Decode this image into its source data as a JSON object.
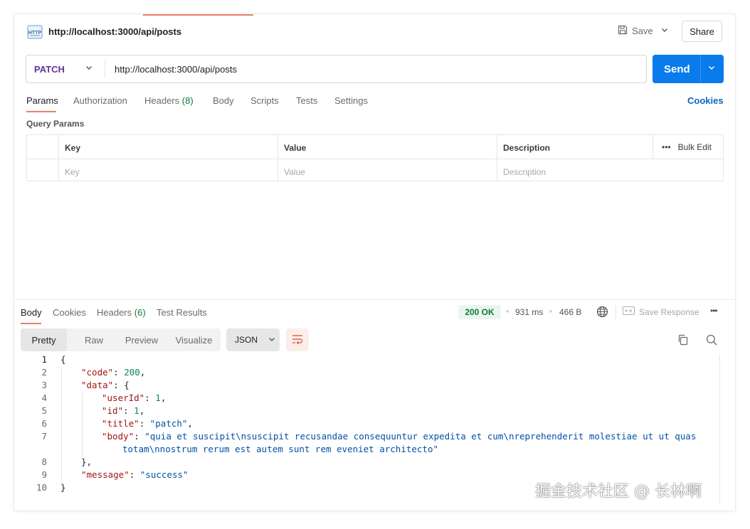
{
  "header": {
    "request_url": "http://localhost:3000/api/posts",
    "save_label": "Save",
    "share_label": "Share"
  },
  "request": {
    "method": "PATCH",
    "url": "http://localhost:3000/api/posts",
    "send_label": "Send"
  },
  "request_tabs": [
    {
      "label": "Params",
      "active": true
    },
    {
      "label": "Authorization"
    },
    {
      "label": "Headers",
      "count": "(8)"
    },
    {
      "label": "Body"
    },
    {
      "label": "Scripts"
    },
    {
      "label": "Tests"
    },
    {
      "label": "Settings"
    }
  ],
  "cookies_link": "Cookies",
  "query_params": {
    "title": "Query Params",
    "columns": [
      "Key",
      "Value",
      "Description"
    ],
    "bulk_edit": "Bulk Edit",
    "placeholders": [
      "Key",
      "Value",
      "Description"
    ]
  },
  "response_tabs": [
    {
      "label": "Body",
      "active": true
    },
    {
      "label": "Cookies"
    },
    {
      "label": "Headers",
      "count": "(6)"
    },
    {
      "label": "Test Results"
    }
  ],
  "response_meta": {
    "status": "200 OK",
    "time": "931 ms",
    "size": "466 B",
    "save_response": "Save Response"
  },
  "format_tabs": [
    "Pretty",
    "Raw",
    "Preview",
    "Visualize"
  ],
  "format_active": "Pretty",
  "language": "JSON",
  "code": {
    "line_numbers": [
      "1",
      "2",
      "3",
      "4",
      "5",
      "6",
      "7",
      "8",
      "9",
      "10"
    ],
    "lines": {
      "l1": "{",
      "l2_key": "\"code\"",
      "l2_val": "200",
      "l3_key": "\"data\"",
      "l3_rest": ": {",
      "l4_key": "\"userId\"",
      "l4_val": "1",
      "l5_key": "\"id\"",
      "l5_val": "1",
      "l6_key": "\"title\"",
      "l6_val": "\"patch\"",
      "l7_key": "\"body\"",
      "l7_val_a": "\"quia et suscipit\\nsuscipit recusandae consequuntur expedita et cum\\nreprehenderit molestiae ut ut quas",
      "l7_val_b": "totam\\nnostrum rerum est autem sunt rem eveniet architecto\"",
      "l8": "},",
      "l9_key": "\"message\"",
      "l9_val": "\"success\"",
      "l10": "}"
    }
  },
  "watermark": "掘金技术社区 @ 长林啊",
  "colors": {
    "accent_orange": "#e8806a",
    "send_blue": "#097bed",
    "method_purple": "#623497",
    "status_green": "#0e7a3f",
    "cookies_blue": "#0a66c2"
  },
  "icons": [
    "http-file-icon",
    "save-icon",
    "chevron-down-icon",
    "more-icon",
    "globe-icon",
    "save-response-icon",
    "wrap-icon",
    "copy-icon",
    "search-icon"
  ]
}
